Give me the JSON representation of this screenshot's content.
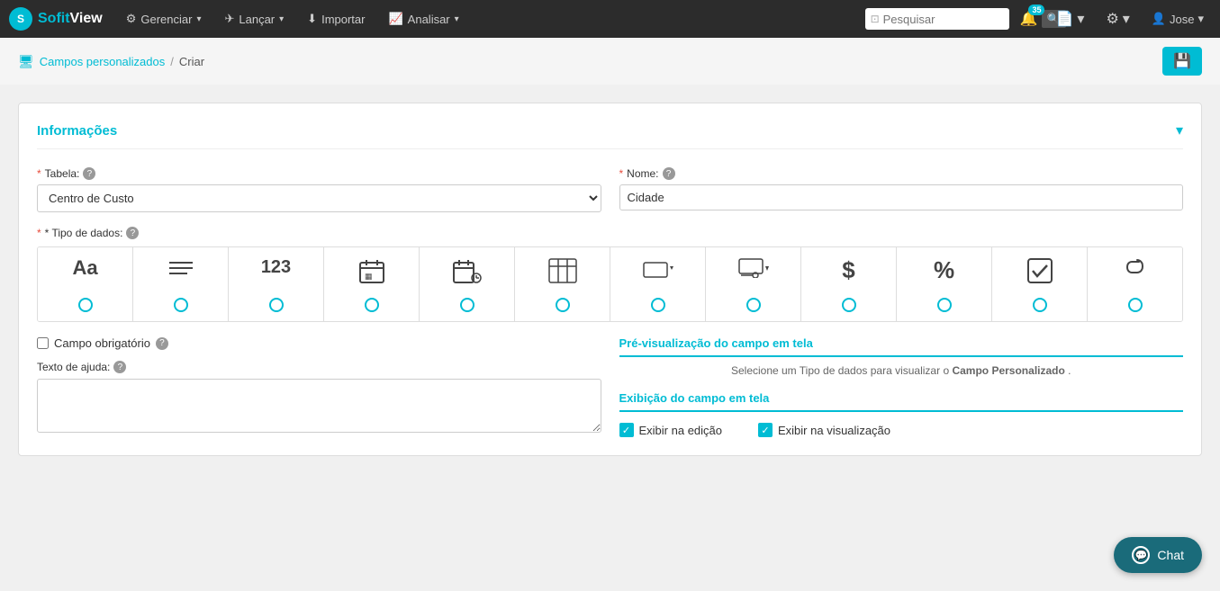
{
  "brand": {
    "circle_text": "S",
    "name_part1": "Sofit",
    "name_part2": "View"
  },
  "navbar": {
    "items": [
      {
        "label": "Gerenciar",
        "has_dropdown": true
      },
      {
        "label": "Lançar",
        "has_dropdown": true
      },
      {
        "label": "Importar",
        "has_dropdown": false
      },
      {
        "label": "Analisar",
        "has_dropdown": true
      }
    ],
    "search_placeholder": "Pesquisar",
    "notification_count": "35",
    "user_name": "Jose"
  },
  "breadcrumb": {
    "link_label": "Campos personalizados",
    "separator": "/",
    "current": "Criar"
  },
  "card": {
    "title": "Informações"
  },
  "form": {
    "table_label": "* Tabela:",
    "table_value": "Centro de Custo",
    "name_label": "* Nome:",
    "name_value": "Cidade",
    "data_type_label": "* Tipo de dados:",
    "data_types": [
      {
        "icon": "Aa",
        "type": "text"
      },
      {
        "icon": "≡",
        "type": "textarea"
      },
      {
        "icon": "123",
        "type": "number"
      },
      {
        "icon": "📅",
        "type": "date"
      },
      {
        "icon": "📅⏱",
        "type": "datetime"
      },
      {
        "icon": "📊",
        "type": "table"
      },
      {
        "icon": "⬜→",
        "type": "select"
      },
      {
        "icon": "⬜↓",
        "type": "multiselect"
      },
      {
        "icon": "$",
        "type": "currency"
      },
      {
        "icon": "%",
        "type": "percent"
      },
      {
        "icon": "✔",
        "type": "checkbox"
      },
      {
        "icon": "📎",
        "type": "attachment"
      }
    ],
    "required_label": "Campo obrigatório",
    "help_text_label": "Texto de ajuda:",
    "preview_title": "Pré-visualização do campo em tela",
    "preview_hint": "Selecione um Tipo de dados para visualizar o Campo Personalizado.",
    "display_title": "Exibição do campo em tela",
    "show_edit_label": "Exibir na edição",
    "show_view_label": "Exibir na visualização",
    "show_edit_checked": true,
    "show_view_checked": true
  },
  "chat_button": {
    "label": "Chat"
  }
}
